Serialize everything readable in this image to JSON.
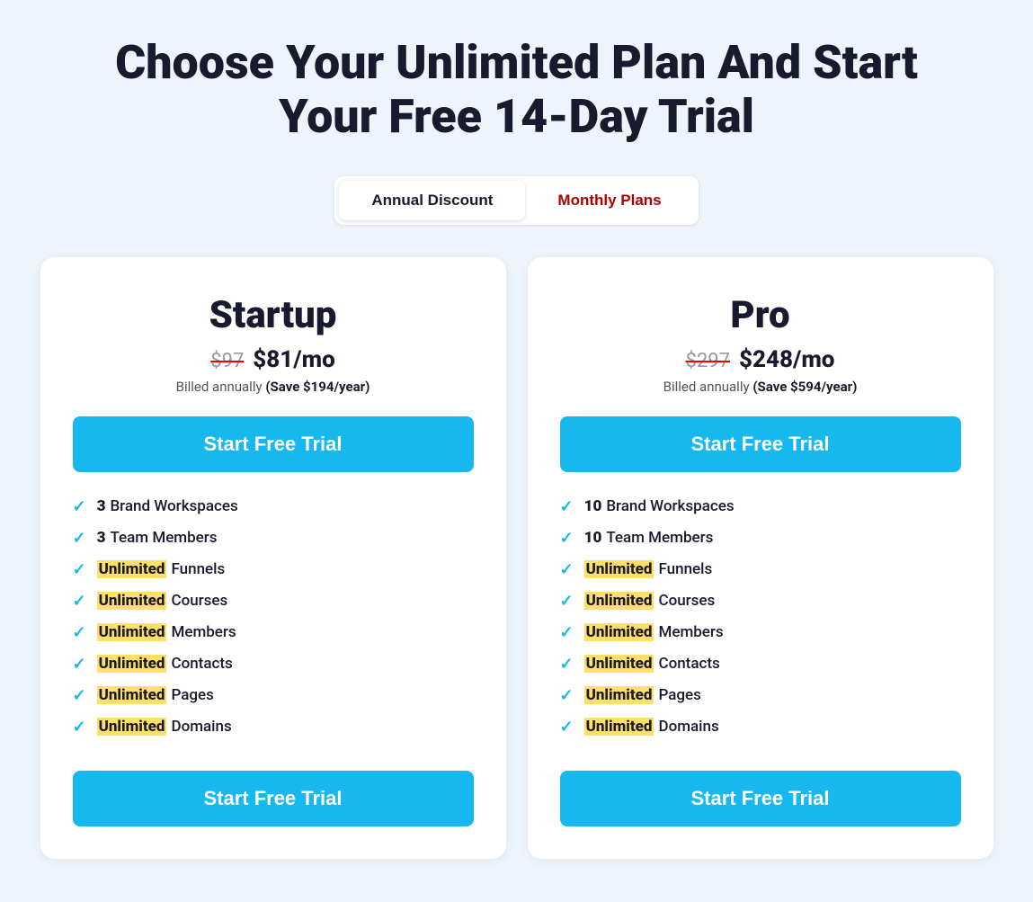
{
  "header": {
    "title": "Choose Your Unlimited Plan And Start Your Free 14-Day Trial"
  },
  "toggle": {
    "annual_label": "Annual Discount",
    "monthly_label": "Monthly Plans"
  },
  "plans": [
    {
      "name": "Startup",
      "original_price": "$97",
      "current_price": "$81/mo",
      "billing": "Billed annually",
      "savings": "(Save $194/year)",
      "cta_top": "Start Free Trial",
      "cta_bottom": "Start Free Trial",
      "features": [
        {
          "number": "3",
          "highlight": null,
          "text": "Brand Workspaces"
        },
        {
          "number": "3",
          "highlight": null,
          "text": "Team Members"
        },
        {
          "number": null,
          "highlight": "Unlimited",
          "text": "Funnels"
        },
        {
          "number": null,
          "highlight": "Unlimited",
          "text": "Courses"
        },
        {
          "number": null,
          "highlight": "Unlimited",
          "text": "Members"
        },
        {
          "number": null,
          "highlight": "Unlimited",
          "text": "Contacts"
        },
        {
          "number": null,
          "highlight": "Unlimited",
          "text": "Pages"
        },
        {
          "number": null,
          "highlight": "Unlimited",
          "text": "Domains"
        }
      ]
    },
    {
      "name": "Pro",
      "original_price": "$297",
      "current_price": "$248/mo",
      "billing": "Billed annually",
      "savings": "(Save $594/year)",
      "cta_top": "Start Free Trial",
      "cta_bottom": "Start Free Trial",
      "features": [
        {
          "number": "10",
          "highlight": null,
          "text": "Brand Workspaces"
        },
        {
          "number": "10",
          "highlight": null,
          "text": "Team Members"
        },
        {
          "number": null,
          "highlight": "Unlimited",
          "text": "Funnels"
        },
        {
          "number": null,
          "highlight": "Unlimited",
          "text": "Courses"
        },
        {
          "number": null,
          "highlight": "Unlimited",
          "text": "Members"
        },
        {
          "number": null,
          "highlight": "Unlimited",
          "text": "Contacts"
        },
        {
          "number": null,
          "highlight": "Unlimited",
          "text": "Pages"
        },
        {
          "number": null,
          "highlight": "Unlimited",
          "text": "Domains"
        }
      ]
    }
  ]
}
